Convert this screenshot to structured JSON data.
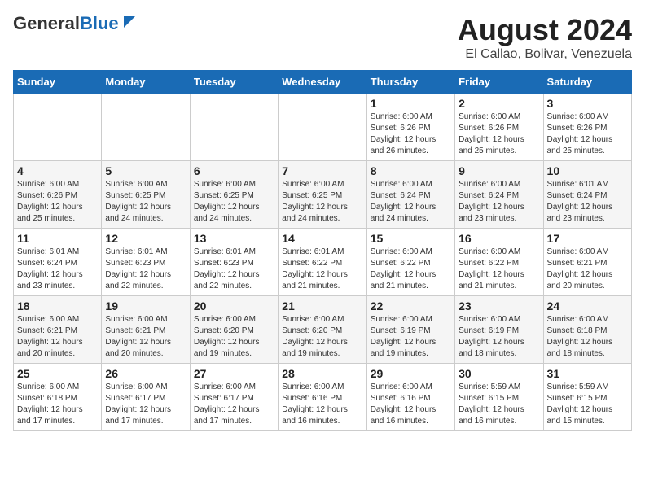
{
  "header": {
    "logo_general": "General",
    "logo_blue": "Blue",
    "title": "August 2024",
    "subtitle": "El Callao, Bolivar, Venezuela"
  },
  "days_of_week": [
    "Sunday",
    "Monday",
    "Tuesday",
    "Wednesday",
    "Thursday",
    "Friday",
    "Saturday"
  ],
  "weeks": [
    [
      {
        "date": "",
        "info": ""
      },
      {
        "date": "",
        "info": ""
      },
      {
        "date": "",
        "info": ""
      },
      {
        "date": "",
        "info": ""
      },
      {
        "date": "1",
        "info": "Sunrise: 6:00 AM\nSunset: 6:26 PM\nDaylight: 12 hours\nand 26 minutes."
      },
      {
        "date": "2",
        "info": "Sunrise: 6:00 AM\nSunset: 6:26 PM\nDaylight: 12 hours\nand 25 minutes."
      },
      {
        "date": "3",
        "info": "Sunrise: 6:00 AM\nSunset: 6:26 PM\nDaylight: 12 hours\nand 25 minutes."
      }
    ],
    [
      {
        "date": "4",
        "info": "Sunrise: 6:00 AM\nSunset: 6:26 PM\nDaylight: 12 hours\nand 25 minutes."
      },
      {
        "date": "5",
        "info": "Sunrise: 6:00 AM\nSunset: 6:25 PM\nDaylight: 12 hours\nand 24 minutes."
      },
      {
        "date": "6",
        "info": "Sunrise: 6:00 AM\nSunset: 6:25 PM\nDaylight: 12 hours\nand 24 minutes."
      },
      {
        "date": "7",
        "info": "Sunrise: 6:00 AM\nSunset: 6:25 PM\nDaylight: 12 hours\nand 24 minutes."
      },
      {
        "date": "8",
        "info": "Sunrise: 6:00 AM\nSunset: 6:24 PM\nDaylight: 12 hours\nand 24 minutes."
      },
      {
        "date": "9",
        "info": "Sunrise: 6:00 AM\nSunset: 6:24 PM\nDaylight: 12 hours\nand 23 minutes."
      },
      {
        "date": "10",
        "info": "Sunrise: 6:01 AM\nSunset: 6:24 PM\nDaylight: 12 hours\nand 23 minutes."
      }
    ],
    [
      {
        "date": "11",
        "info": "Sunrise: 6:01 AM\nSunset: 6:24 PM\nDaylight: 12 hours\nand 23 minutes."
      },
      {
        "date": "12",
        "info": "Sunrise: 6:01 AM\nSunset: 6:23 PM\nDaylight: 12 hours\nand 22 minutes."
      },
      {
        "date": "13",
        "info": "Sunrise: 6:01 AM\nSunset: 6:23 PM\nDaylight: 12 hours\nand 22 minutes."
      },
      {
        "date": "14",
        "info": "Sunrise: 6:01 AM\nSunset: 6:22 PM\nDaylight: 12 hours\nand 21 minutes."
      },
      {
        "date": "15",
        "info": "Sunrise: 6:00 AM\nSunset: 6:22 PM\nDaylight: 12 hours\nand 21 minutes."
      },
      {
        "date": "16",
        "info": "Sunrise: 6:00 AM\nSunset: 6:22 PM\nDaylight: 12 hours\nand 21 minutes."
      },
      {
        "date": "17",
        "info": "Sunrise: 6:00 AM\nSunset: 6:21 PM\nDaylight: 12 hours\nand 20 minutes."
      }
    ],
    [
      {
        "date": "18",
        "info": "Sunrise: 6:00 AM\nSunset: 6:21 PM\nDaylight: 12 hours\nand 20 minutes."
      },
      {
        "date": "19",
        "info": "Sunrise: 6:00 AM\nSunset: 6:21 PM\nDaylight: 12 hours\nand 20 minutes."
      },
      {
        "date": "20",
        "info": "Sunrise: 6:00 AM\nSunset: 6:20 PM\nDaylight: 12 hours\nand 19 minutes."
      },
      {
        "date": "21",
        "info": "Sunrise: 6:00 AM\nSunset: 6:20 PM\nDaylight: 12 hours\nand 19 minutes."
      },
      {
        "date": "22",
        "info": "Sunrise: 6:00 AM\nSunset: 6:19 PM\nDaylight: 12 hours\nand 19 minutes."
      },
      {
        "date": "23",
        "info": "Sunrise: 6:00 AM\nSunset: 6:19 PM\nDaylight: 12 hours\nand 18 minutes."
      },
      {
        "date": "24",
        "info": "Sunrise: 6:00 AM\nSunset: 6:18 PM\nDaylight: 12 hours\nand 18 minutes."
      }
    ],
    [
      {
        "date": "25",
        "info": "Sunrise: 6:00 AM\nSunset: 6:18 PM\nDaylight: 12 hours\nand 17 minutes."
      },
      {
        "date": "26",
        "info": "Sunrise: 6:00 AM\nSunset: 6:17 PM\nDaylight: 12 hours\nand 17 minutes."
      },
      {
        "date": "27",
        "info": "Sunrise: 6:00 AM\nSunset: 6:17 PM\nDaylight: 12 hours\nand 17 minutes."
      },
      {
        "date": "28",
        "info": "Sunrise: 6:00 AM\nSunset: 6:16 PM\nDaylight: 12 hours\nand 16 minutes."
      },
      {
        "date": "29",
        "info": "Sunrise: 6:00 AM\nSunset: 6:16 PM\nDaylight: 12 hours\nand 16 minutes."
      },
      {
        "date": "30",
        "info": "Sunrise: 5:59 AM\nSunset: 6:15 PM\nDaylight: 12 hours\nand 16 minutes."
      },
      {
        "date": "31",
        "info": "Sunrise: 5:59 AM\nSunset: 6:15 PM\nDaylight: 12 hours\nand 15 minutes."
      }
    ]
  ]
}
